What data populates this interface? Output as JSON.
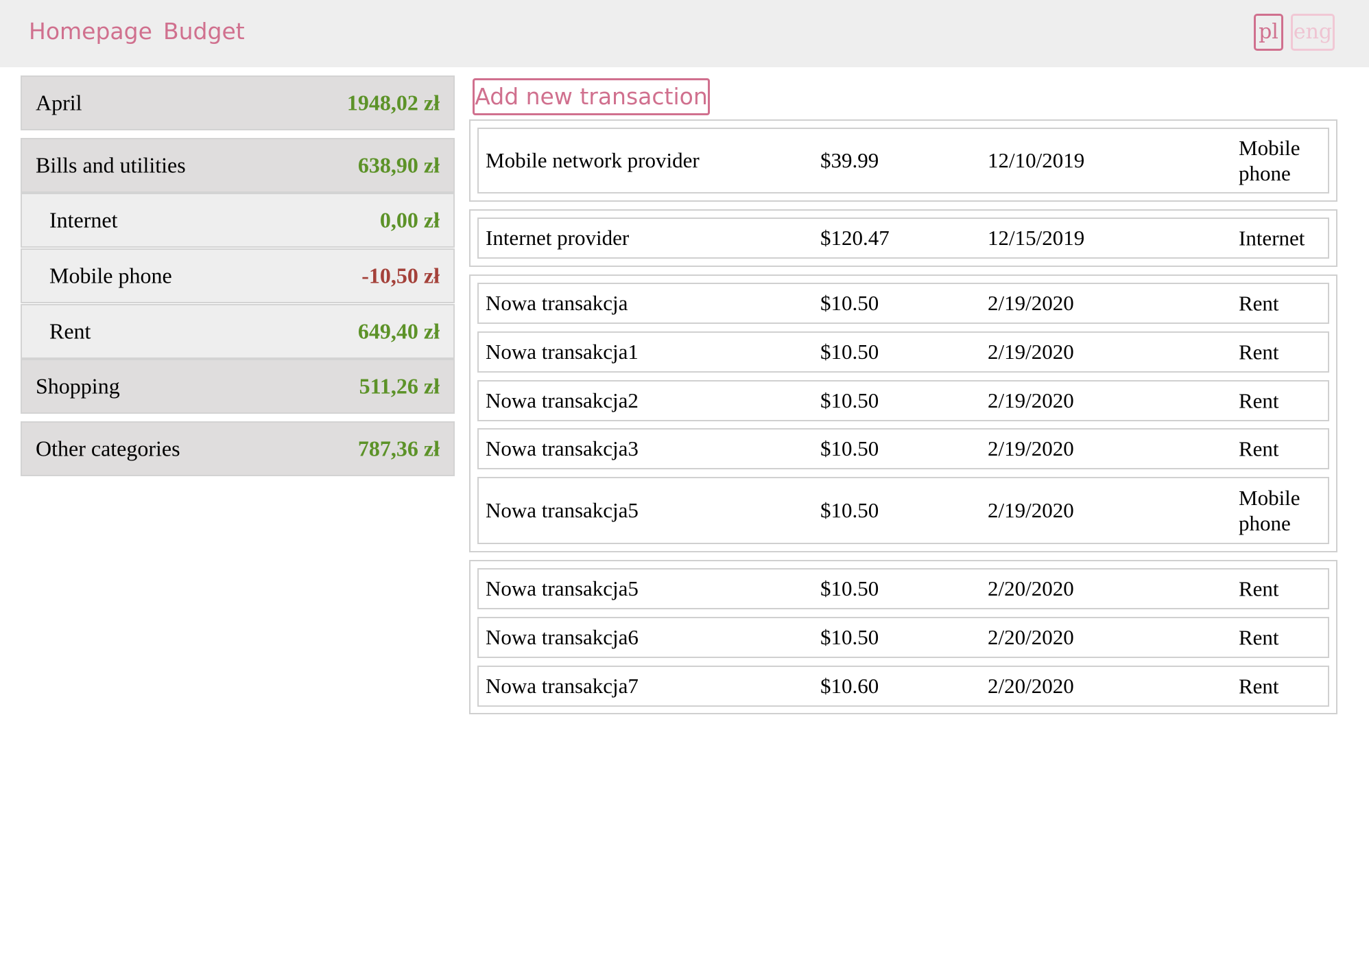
{
  "nav": {
    "homepage": "Homepage",
    "budget": "Budget"
  },
  "lang": {
    "pl": "pl",
    "eng": "eng"
  },
  "colors": {
    "accent": "#d0708e",
    "positive": "#5c9228",
    "negative": "#a4413a"
  },
  "sidebar": {
    "categories": [
      {
        "name": "April",
        "amount": "1948,02 zł",
        "level": "main",
        "sign": "positive"
      },
      {
        "name": "Bills and utilities",
        "amount": "638,90 zł",
        "level": "main",
        "sign": "positive"
      },
      {
        "name": "Internet",
        "amount": "0,00 zł",
        "level": "sub",
        "sign": "positive"
      },
      {
        "name": "Mobile phone",
        "amount": "-10,50 zł",
        "level": "sub",
        "sign": "negative"
      },
      {
        "name": "Rent",
        "amount": "649,40 zł",
        "level": "sub",
        "sign": "positive"
      },
      {
        "name": "Shopping",
        "amount": "511,26 zł",
        "level": "main",
        "sign": "positive"
      },
      {
        "name": "Other categories",
        "amount": "787,36 zł",
        "level": "main",
        "sign": "positive"
      }
    ]
  },
  "main": {
    "add_button": "Add new transaction",
    "groups": [
      {
        "transactions": [
          {
            "name": "Mobile network provider",
            "amount": "$39.99",
            "date": "12/10/2019",
            "category": "Mobile phone"
          }
        ]
      },
      {
        "transactions": [
          {
            "name": "Internet provider",
            "amount": "$120.47",
            "date": "12/15/2019",
            "category": "Internet"
          }
        ]
      },
      {
        "transactions": [
          {
            "name": "Nowa transakcja",
            "amount": "$10.50",
            "date": "2/19/2020",
            "category": "Rent"
          },
          {
            "name": "Nowa transakcja1",
            "amount": "$10.50",
            "date": "2/19/2020",
            "category": "Rent"
          },
          {
            "name": "Nowa transakcja2",
            "amount": "$10.50",
            "date": "2/19/2020",
            "category": "Rent"
          },
          {
            "name": "Nowa transakcja3",
            "amount": "$10.50",
            "date": "2/19/2020",
            "category": "Rent"
          },
          {
            "name": "Nowa transakcja5",
            "amount": "$10.50",
            "date": "2/19/2020",
            "category": "Mobile phone"
          }
        ]
      },
      {
        "transactions": [
          {
            "name": "Nowa transakcja5",
            "amount": "$10.50",
            "date": "2/20/2020",
            "category": "Rent"
          },
          {
            "name": "Nowa transakcja6",
            "amount": "$10.50",
            "date": "2/20/2020",
            "category": "Rent"
          },
          {
            "name": "Nowa transakcja7",
            "amount": "$10.60",
            "date": "2/20/2020",
            "category": "Rent"
          }
        ]
      }
    ]
  }
}
